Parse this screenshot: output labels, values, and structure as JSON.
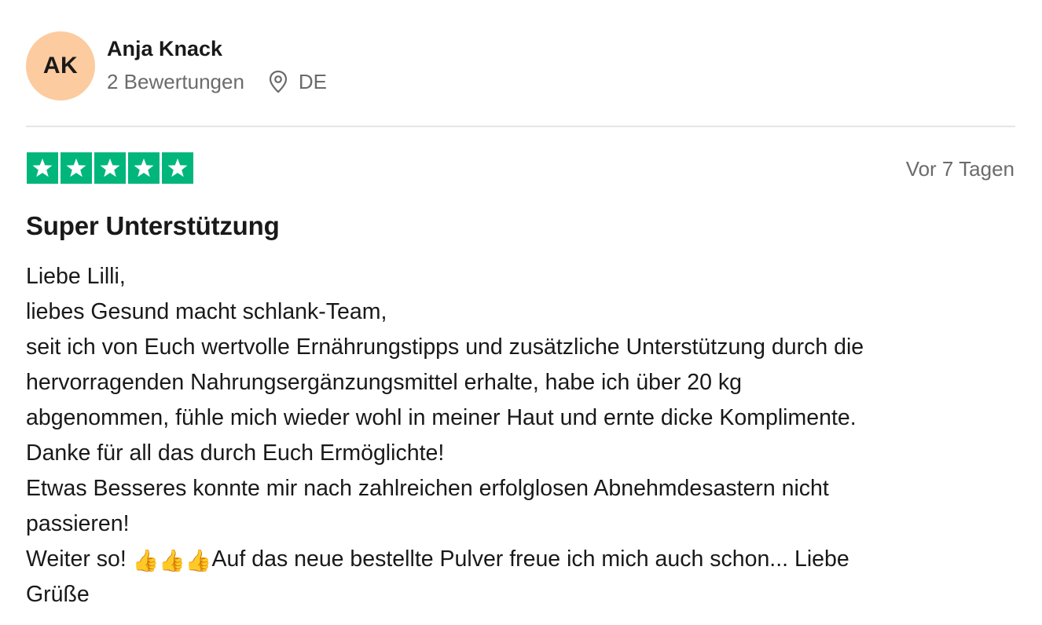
{
  "consumer": {
    "initials": "AK",
    "name": "Anja Knack",
    "review_count": "2 Bewertungen",
    "location_icon": "location-pin-icon",
    "country": "DE",
    "avatar_color": "#fccb9f"
  },
  "review": {
    "rating": 5,
    "rating_max": 5,
    "star_color": "#00b67a",
    "date": "Vor 7 Tagen",
    "title": "Super Unterstützung",
    "body_lines": [
      "Liebe Lilli,",
      "liebes Gesund macht schlank-Team,",
      "seit ich von Euch wertvolle Ernährungstipps und zusätzliche Unterstützung durch die",
      "hervorragenden Nahrungsergänzungsmittel erhalte, habe ich über 20 kg",
      "abgenommen, fühle mich wieder wohl in meiner Haut und ernte dicke Komplimente.",
      "Danke für all das durch Euch Ermöglichte!",
      "Etwas Besseres konnte mir nach zahlreichen erfolglosen Abnehmdesastern nicht",
      "passieren!"
    ],
    "line9_start": "Weiter so! ",
    "emojis": "👍👍👍",
    "line9_end": "Auf das neue bestellte Pulver freue ich mich auch schon... Liebe",
    "last_line": "Grüße"
  }
}
